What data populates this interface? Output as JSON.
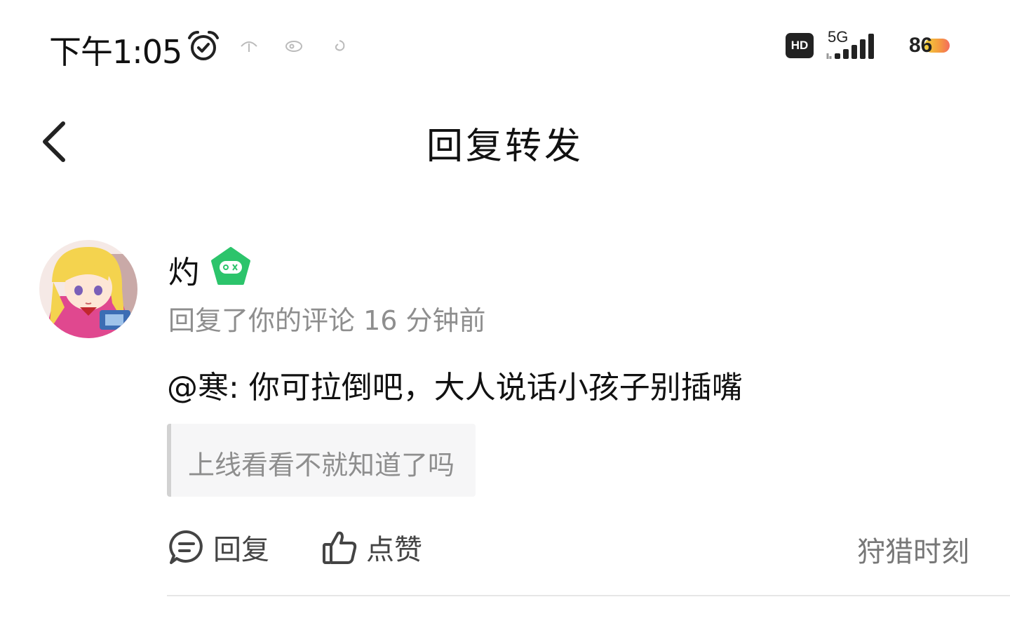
{
  "status_bar": {
    "time": "下午1:05",
    "network_type": "5G",
    "hd_label": "HD",
    "battery": "86"
  },
  "header": {
    "title": "回复转发"
  },
  "comment": {
    "username": "灼",
    "meta": "回复了你的评论 16 分钟前",
    "text": "@寒: 你可拉倒吧，大人说话小孩子别插嘴",
    "quoted": "上线看看不就知道了吗",
    "actions": {
      "reply_label": "回复",
      "like_label": "点赞"
    },
    "source_link": "狩猎时刻"
  },
  "icons": {
    "back": "chevron-left-icon",
    "alarm": "alarm-clock-icon",
    "badge": "gamepad-badge-icon",
    "reply": "comment-bubble-icon",
    "like": "thumbs-up-icon"
  },
  "colors": {
    "badge_green": "#2cc46b",
    "meta_gray": "#8e8e8e",
    "quote_bg": "#f6f6f7"
  }
}
